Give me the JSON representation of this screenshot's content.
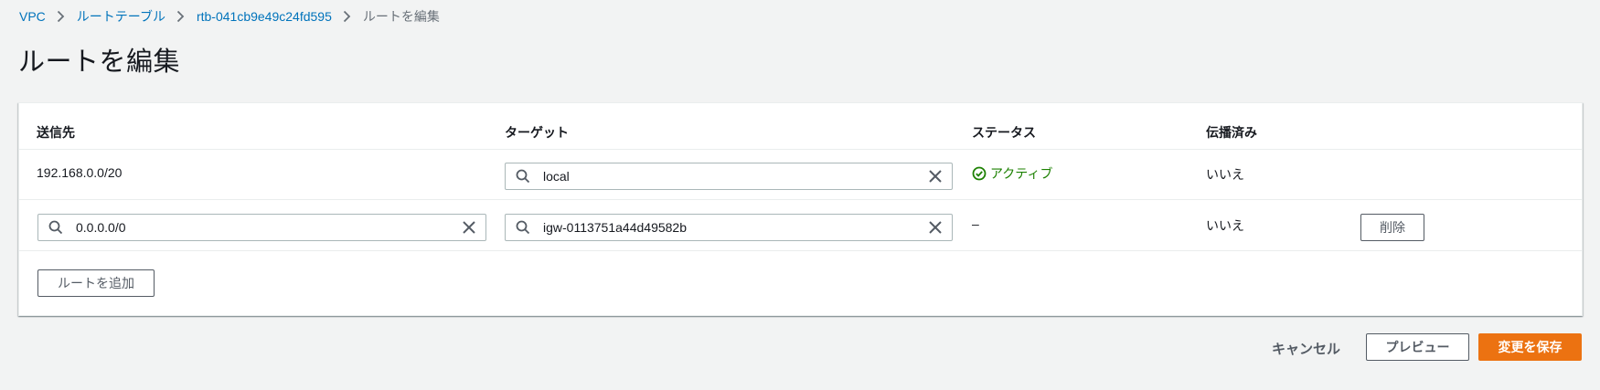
{
  "breadcrumb": {
    "items": [
      {
        "label": "VPC"
      },
      {
        "label": "ルートテーブル"
      },
      {
        "label": "rtb-041cb9e49c24fd595"
      }
    ],
    "current": "ルートを編集"
  },
  "page": {
    "title": "ルートを編集"
  },
  "table": {
    "headers": {
      "destination": "送信先",
      "target": "ターゲット",
      "status": "ステータス",
      "propagated": "伝播済み"
    },
    "rows": [
      {
        "destination": "192.168.0.0/20",
        "target": "local",
        "status": "アクティブ",
        "propagated": "いいえ"
      },
      {
        "destination": "0.0.0.0/0",
        "target": "igw-0113751a44d49582b",
        "status": "–",
        "propagated": "いいえ",
        "remove_label": "削除"
      }
    ],
    "add_route_label": "ルートを追加"
  },
  "footer": {
    "cancel_label": "キャンセル",
    "preview_label": "プレビュー",
    "save_label": "変更を保存"
  },
  "colors": {
    "link": "#0073bb",
    "active_status": "#1d8102",
    "primary": "#ec7211",
    "background": "#f2f3f3"
  },
  "icons": {
    "breadcrumb_separator": "chevron-right-icon",
    "search": "search-icon",
    "clear": "close-icon",
    "status_active": "check-circle-icon"
  }
}
